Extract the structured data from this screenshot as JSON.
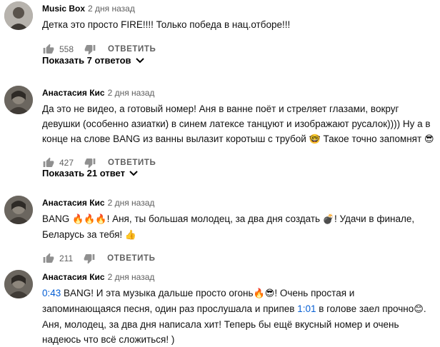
{
  "comments": [
    {
      "author": "Music Box",
      "date": "2 дня назад",
      "segments": [
        {
          "type": "text",
          "value": "Детка это просто FIRE!!!! Только победа в нац.отборе!!!"
        }
      ],
      "likes": "558",
      "reply_label": "ОТВЕТИТЬ",
      "replies_label": "Показать 7 ответов"
    },
    {
      "author": "Анастасия Кис",
      "date": "2 дня назад",
      "segments": [
        {
          "type": "text",
          "value": "Да это не видео, а готовый номер! Аня в ванне поёт и стреляет глазами, вокруг девушки (особенно азиатки) в синем латексе танцуют и изображают русалок)))) Ну а в конце на слове BANG из ванны вылазит коротыш с трубой "
        },
        {
          "type": "emoji",
          "value": "🤓"
        },
        {
          "type": "text",
          "value": " Такое точно запомнят "
        },
        {
          "type": "emoji",
          "value": "😎"
        }
      ],
      "likes": "427",
      "reply_label": "ОТВЕТИТЬ",
      "replies_label": "Показать 21 ответ"
    },
    {
      "author": "Анастасия Кис",
      "date": "2 дня назад",
      "segments": [
        {
          "type": "text",
          "value": "BANG "
        },
        {
          "type": "emoji",
          "value": "🔥🔥🔥"
        },
        {
          "type": "text",
          "value": "! Аня, ты большая молодец, за два дня создать  "
        },
        {
          "type": "emoji",
          "value": "💣"
        },
        {
          "type": "text",
          "value": "!  Удачи в финале, Беларусь за тебя! "
        },
        {
          "type": "emoji",
          "value": "👍"
        }
      ],
      "likes": "211",
      "reply_label": "ОТВЕТИТЬ"
    },
    {
      "author": "Анастасия Кис",
      "date": "2 дня назад",
      "segments": [
        {
          "type": "timestamp",
          "value": "0:43"
        },
        {
          "type": "text",
          "value": " BANG! И эта музыка дальше просто огонь"
        },
        {
          "type": "emoji",
          "value": "🔥😎"
        },
        {
          "type": "text",
          "value": "! Очень простая и запоминающаяся песня, один раз прослушала и припев "
        },
        {
          "type": "timestamp",
          "value": "1:01"
        },
        {
          "type": "text",
          "value": " в голове заел прочно"
        },
        {
          "type": "emoji",
          "value": "😊"
        },
        {
          "type": "text",
          "value": ". Аня, молодец, за два дня написала хит! Теперь бы ещё вкусный номер и очень надеюсь что всё сложиться! )"
        }
      ]
    }
  ],
  "icons": {
    "like": "thumb-up-icon",
    "dislike": "thumb-down-icon",
    "expand": "chevron-down-icon"
  },
  "colors": {
    "link": "#065fd4",
    "secondary_text": "#606060"
  }
}
